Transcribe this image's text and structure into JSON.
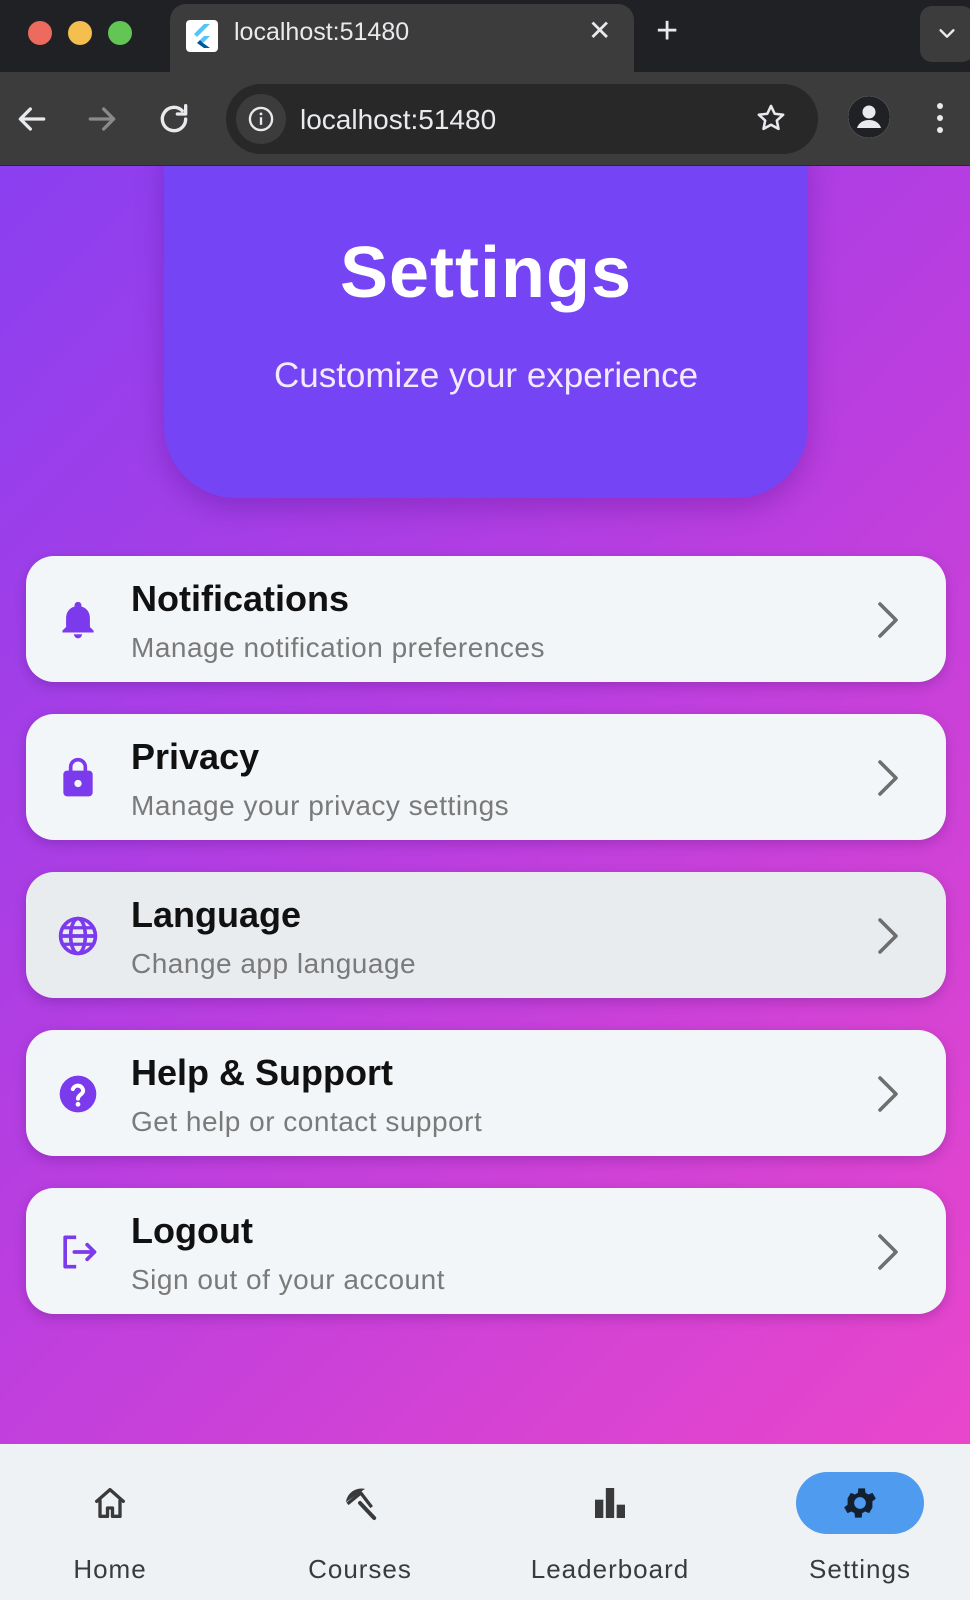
{
  "browser": {
    "tab_title": "localhost:51480",
    "tab_close": "✕",
    "new_tab": "+",
    "url": "localhost:51480"
  },
  "header": {
    "title": "Settings",
    "subtitle": "Customize your experience"
  },
  "settings": {
    "items": [
      {
        "title": "Notifications",
        "subtitle": "Manage notification preferences",
        "icon": "bell-icon"
      },
      {
        "title": "Privacy",
        "subtitle": "Manage your privacy settings",
        "icon": "lock-icon"
      },
      {
        "title": "Language",
        "subtitle": "Change app language",
        "icon": "globe-icon"
      },
      {
        "title": "Help & Support",
        "subtitle": "Get help or contact support",
        "icon": "help-circle-icon"
      },
      {
        "title": "Logout",
        "subtitle": "Sign out of your account",
        "icon": "logout-icon"
      }
    ]
  },
  "bottom_nav": {
    "items": [
      {
        "label": "Home",
        "icon": "home-icon"
      },
      {
        "label": "Courses",
        "icon": "beach-umbrella-icon"
      },
      {
        "label": "Leaderboard",
        "icon": "bar-chart-icon"
      },
      {
        "label": "Settings",
        "icon": "gear-icon",
        "active": true
      }
    ]
  },
  "colors": {
    "accent": "#7545f5",
    "icon_purple": "#7c3aed",
    "active_nav": "#4f9bef",
    "gradient_start": "#8a3ff0",
    "gradient_end": "#f047c8"
  }
}
